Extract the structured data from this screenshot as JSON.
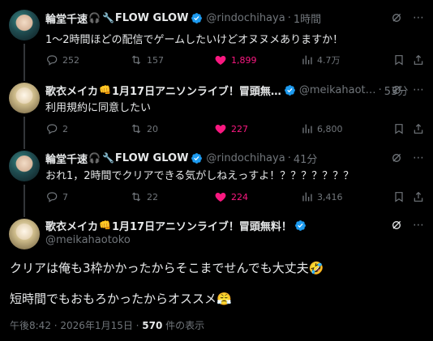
{
  "tweets": [
    {
      "name": "輪堂千速",
      "name_suffix": "FLOW GLOW",
      "emoji_1": "🎧",
      "emoji_2": "🔧",
      "handle": "@rindochihaya",
      "time": "1時間",
      "text": "1〜2時間ほどの配信でゲームしたいけどオヌヌメありますか！",
      "replies": "252",
      "retweets": "157",
      "likes": "1,899",
      "views": "4.7万",
      "liked": true
    },
    {
      "name": "歌衣メイカ",
      "name_suffix": "1月17日アニソンライブ！冒頭無…",
      "emoji_1": "👊",
      "handle": "@meikahaot…",
      "time": "53分",
      "text": "利用規約に同意したい",
      "replies": "2",
      "retweets": "20",
      "likes": "227",
      "views": "6,800",
      "liked": true
    },
    {
      "name": "輪堂千速",
      "name_suffix": "FLOW GLOW",
      "emoji_1": "🎧",
      "emoji_2": "🔧",
      "handle": "@rindochihaya",
      "time": "41分",
      "text": "おれ1，2時間でクリアできる気がしねえっすよ！？？？？？？？",
      "replies": "7",
      "retweets": "22",
      "likes": "224",
      "views": "3,416",
      "liked": true
    }
  ],
  "main_tweet": {
    "name": "歌衣メイカ",
    "name_suffix": "1月17日アニソンライブ！冒頭無料！",
    "emoji_1": "👊",
    "handle": "@meikahaotoko",
    "line1": "クリアは俺も3枠かかったからそこまでせんでも大丈夫🤣",
    "line2": "短時間でもおもろかったからオススメ😤",
    "meta_time": "午後8:42 · 2026年1月15日 · ",
    "meta_views": "570",
    "meta_views_suffix": " 件の表示"
  },
  "icons": [
    "grok-icon",
    "more-icon",
    "reply-icon",
    "retweet-icon",
    "heart-icon",
    "views-icon",
    "bookmark-icon",
    "share-icon",
    "verified-icon"
  ],
  "colors": {
    "background": "#000000",
    "text": "#e7e9ea",
    "muted": "#71767b",
    "like": "#f91880",
    "verified": "#1d9bf0"
  }
}
